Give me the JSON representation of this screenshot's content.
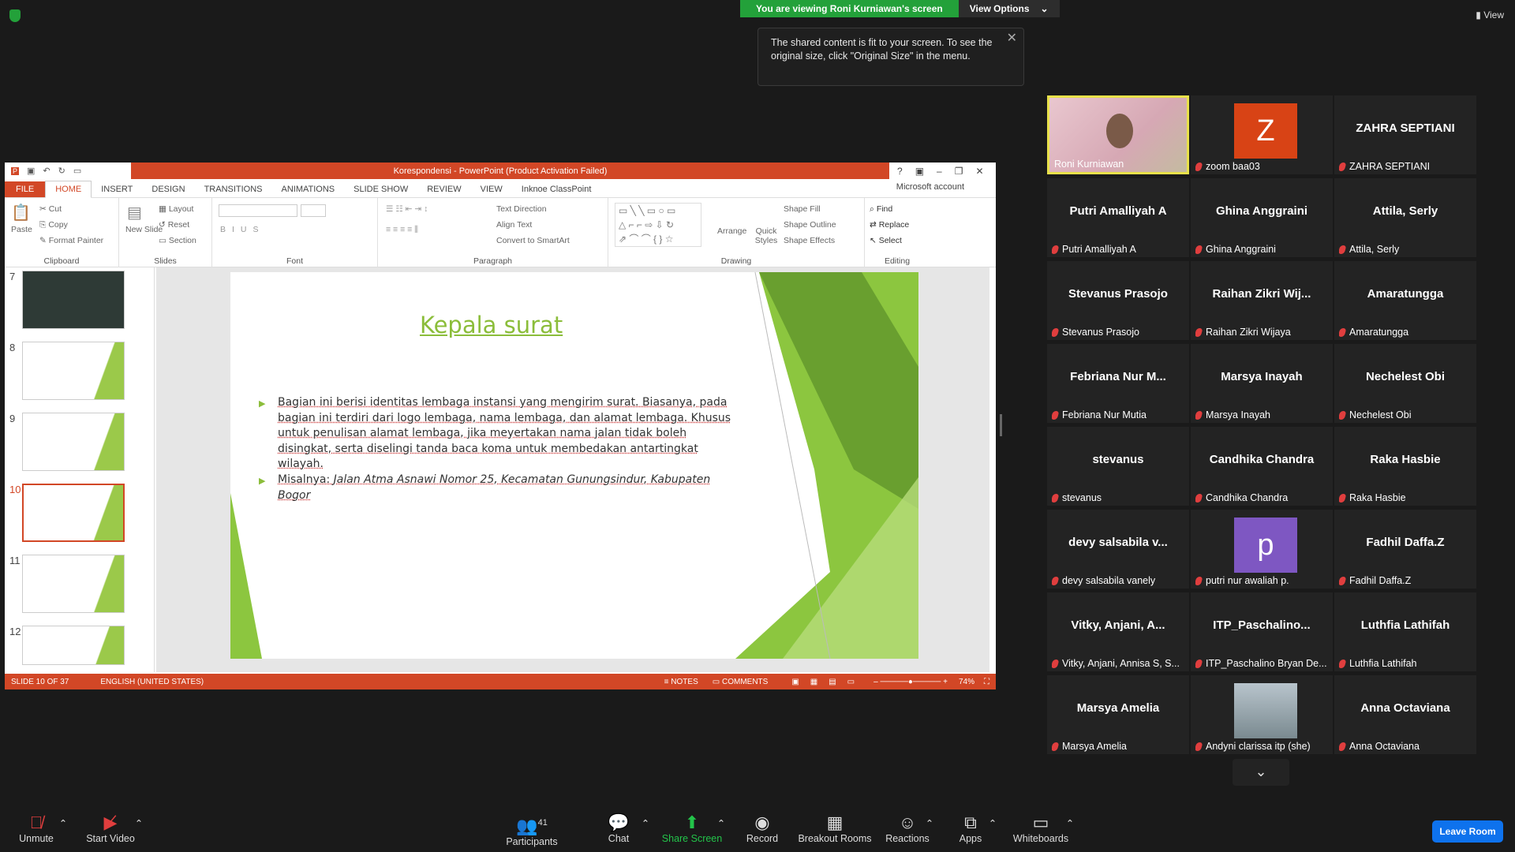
{
  "zoom": {
    "banner_text": "You are viewing Roni Kurniawan's screen",
    "view_options": "View Options",
    "view": "View",
    "tooltip": "The shared content is fit to your screen. To see the original size, click \"Original Size\" in the menu."
  },
  "ppt": {
    "title": "Korespondensi - PowerPoint (Product Activation Failed)",
    "tabs": [
      "FILE",
      "HOME",
      "INSERT",
      "DESIGN",
      "TRANSITIONS",
      "ANIMATIONS",
      "SLIDE SHOW",
      "REVIEW",
      "VIEW",
      "Inknoe ClassPoint"
    ],
    "account": "Microsoft account",
    "ribbon": {
      "paste": "Paste",
      "cut": "Cut",
      "copy": "Copy",
      "format_painter": "Format Painter",
      "clipboard": "Clipboard",
      "new_slide": "New Slide",
      "layout": "Layout",
      "reset": "Reset",
      "section": "Section",
      "slides": "Slides",
      "font": "Font",
      "paragraph": "Paragraph",
      "text_direction": "Text Direction",
      "align_text": "Align Text",
      "convert_smartart": "Convert to SmartArt",
      "arrange": "Arrange",
      "quick_styles": "Quick Styles",
      "shape_fill": "Shape Fill",
      "shape_outline": "Shape Outline",
      "shape_effects": "Shape Effects",
      "drawing": "Drawing",
      "find": "Find",
      "replace": "Replace",
      "select": "Select",
      "editing": "Editing"
    },
    "thumbs": [
      "7",
      "8",
      "9",
      "10",
      "11",
      "12"
    ],
    "slide": {
      "title": "Kepala surat",
      "bullet1": "Bagian ini berisi identitas lembaga instansi yang mengirim surat. Biasanya, pada bagian ini terdiri dari logo lembaga, nama lembaga, dan alamat lembaga. Khusus untuk penulisan alamat lembaga, jika meyertakan nama jalan tidak boleh disingkat, serta diselingi tanda baca koma untuk membedakan antartingkat wilayah.",
      "bullet2_prefix": "Misalnya: ",
      "bullet2_italic": "Jalan Atma Asnawi Nomor 25, Kecamatan Gunungsindur, Kabupaten Bogor"
    },
    "status": {
      "slide": "SLIDE 10 OF 37",
      "language": "ENGLISH (UNITED STATES)",
      "notes": "NOTES",
      "comments": "COMMENTS",
      "zoom": "74%"
    }
  },
  "participants": [
    {
      "big": "",
      "name": "Roni Kurniawan",
      "video": true
    },
    {
      "big": "Z",
      "name": "zoom baa03",
      "avatar": "#d84315"
    },
    {
      "big": "ZAHRA SEPTIANI",
      "name": "ZAHRA SEPTIANI"
    },
    {
      "big": "Putri Amalliyah A",
      "name": "Putri Amalliyah A"
    },
    {
      "big": "Ghina Anggraini",
      "name": "Ghina Anggraini"
    },
    {
      "big": "Attila, Serly",
      "name": "Attila, Serly"
    },
    {
      "big": "Stevanus Prasojo",
      "name": "Stevanus Prasojo"
    },
    {
      "big": "Raihan Zikri Wij...",
      "name": "Raihan Zikri Wijaya"
    },
    {
      "big": "Amaratungga",
      "name": "Amaratungga"
    },
    {
      "big": "Febriana Nur M...",
      "name": "Febriana Nur Mutia"
    },
    {
      "big": "Marsya Inayah",
      "name": "Marsya Inayah"
    },
    {
      "big": "Nechelest Obi",
      "name": "Nechelest Obi"
    },
    {
      "big": "stevanus",
      "name": "stevanus"
    },
    {
      "big": "Candhika Chandra",
      "name": "Candhika Chandra"
    },
    {
      "big": "Raka Hasbie",
      "name": "Raka Hasbie"
    },
    {
      "big": "devy salsabila v...",
      "name": "devy salsabila vanely"
    },
    {
      "big": "p",
      "name": "putri nur awaliah p.",
      "avatar": "#7e57c2"
    },
    {
      "big": "Fadhil Daffa.Z",
      "name": "Fadhil Daffa.Z"
    },
    {
      "big": "Vitky, Anjani, A...",
      "name": "Vitky, Anjani, Annisa S, S..."
    },
    {
      "big": "ITP_Paschalino...",
      "name": "ITP_Paschalino Bryan De..."
    },
    {
      "big": "Luthfia Lathifah",
      "name": "Luthfia Lathifah"
    },
    {
      "big": "Marsya Amelia",
      "name": "Marsya Amelia"
    },
    {
      "big": "",
      "name": "Andyni clarissa itp (she)",
      "photo": true
    },
    {
      "big": "Anna Octaviana",
      "name": "Anna Octaviana"
    }
  ],
  "toolbar": {
    "unmute": "Unmute",
    "start_video": "Start Video",
    "participants": "Participants",
    "participants_count": "41",
    "chat": "Chat",
    "share_screen": "Share Screen",
    "record": "Record",
    "breakout": "Breakout Rooms",
    "reactions": "Reactions",
    "apps": "Apps",
    "whiteboards": "Whiteboards",
    "leave": "Leave Room"
  }
}
